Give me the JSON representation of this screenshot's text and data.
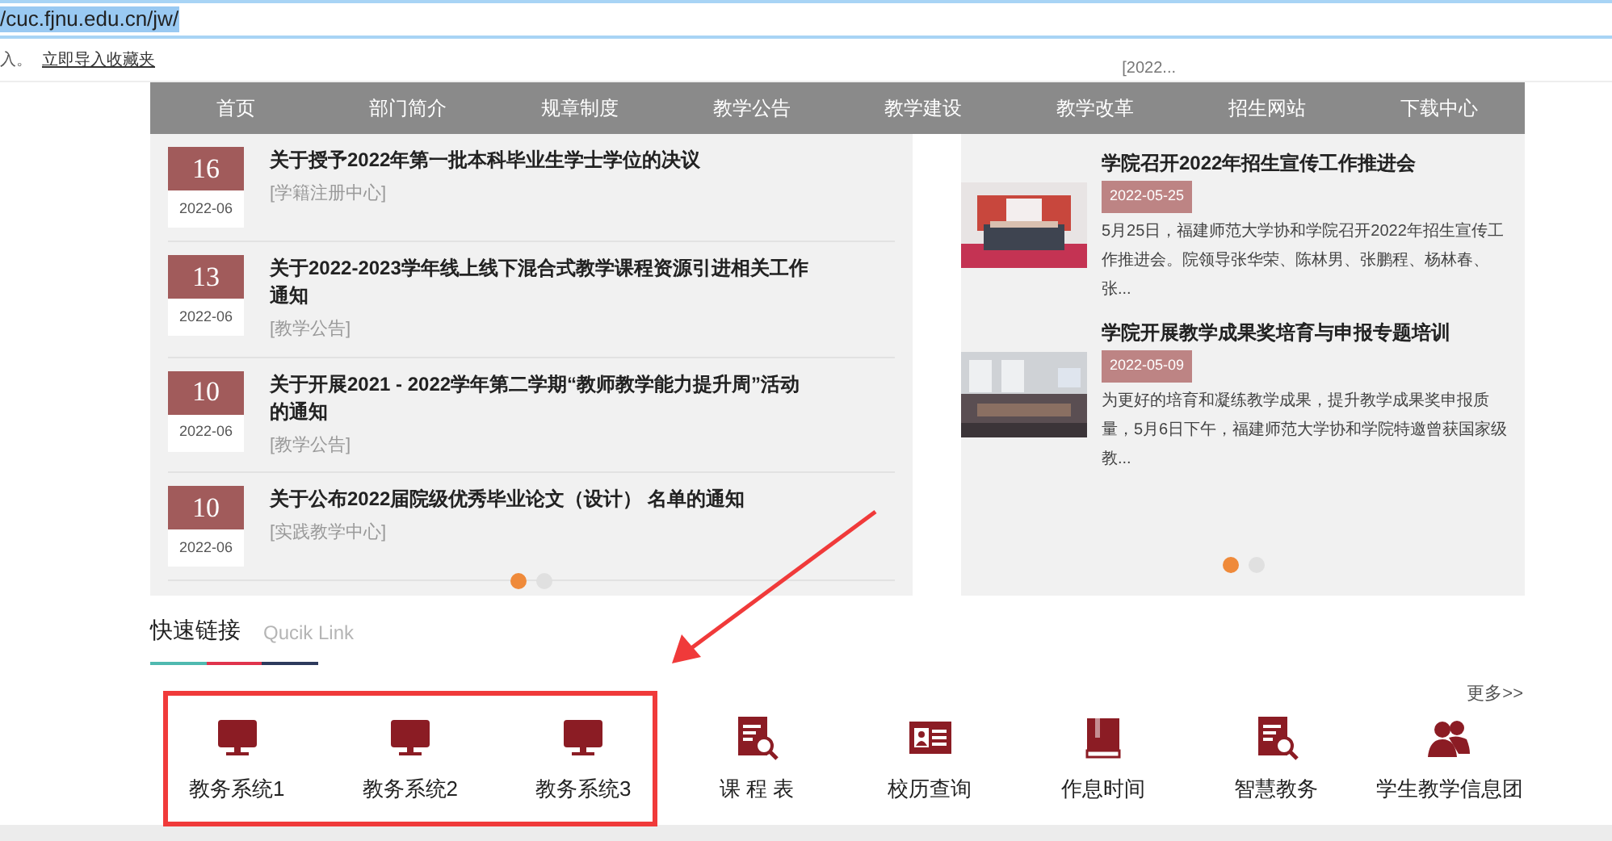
{
  "address_bar": {
    "url": "/cuc.fjnu.edu.cn/jw/"
  },
  "info_bar": {
    "text": "入。",
    "link": "立即导入收藏夹"
  },
  "nav": [
    {
      "label": "首页"
    },
    {
      "label": "部门简介"
    },
    {
      "label": "规章制度"
    },
    {
      "label": "教学公告"
    },
    {
      "label": "教学建设"
    },
    {
      "label": "教学改革"
    },
    {
      "label": "招生网站"
    },
    {
      "label": "下载中心"
    }
  ],
  "notices": [
    {
      "day": "16",
      "month": "2022-06",
      "title": "关于授予2022年第一批本科毕业生学士学位的决议",
      "category": "[学籍注册中心]"
    },
    {
      "day": "13",
      "month": "2022-06",
      "title": "关于2022-2023学年线上线下混合式教学课程资源引进相关工作通知",
      "category": "[教学公告]"
    },
    {
      "day": "10",
      "month": "2022-06",
      "title": "关于开展2021 - 2022学年第二学期“教师教学能力提升周”活动的通知",
      "category": "[教学公告]"
    },
    {
      "day": "10",
      "month": "2022-06",
      "title": "关于公布2022届院级优秀毕业论文（设计） 名单的通知",
      "category": "[实践教学中心]"
    }
  ],
  "notice_pager": [
    {
      "selected": true
    },
    {
      "selected": false
    }
  ],
  "news_overflow_text": "[2022...",
  "news": [
    {
      "title": "学院召开2022年招生宣传工作推进会",
      "date": "2022-05-25",
      "summary": "5月25日，福建师范大学协和学院召开2022年招生宣传工作推进会。院领导张华荣、陈林男、张鹏程、杨林春、张..."
    },
    {
      "title": "学院开展教学成果奖培育与申报专题培训",
      "date": "2022-05-09",
      "summary": "为更好的培育和凝练教学成果，提升教学成果奖申报质量，5月6日下午，福建师范大学协和学院特邀曾获国家级教..."
    }
  ],
  "news_pager": [
    {
      "selected": true
    },
    {
      "selected": false
    }
  ],
  "quick_links": {
    "title": "快速链接",
    "subtitle": "Qucik Link",
    "more": "更多>>",
    "items": [
      {
        "label": "教务系统1",
        "kind": "monitor"
      },
      {
        "label": "教务系统2",
        "kind": "monitor"
      },
      {
        "label": "教务系统3",
        "kind": "monitor"
      },
      {
        "label": "课 程 表",
        "kind": "doc-search"
      },
      {
        "label": "校历查询",
        "kind": "id-card"
      },
      {
        "label": "作息时间",
        "kind": "book"
      },
      {
        "label": "智慧教务",
        "kind": "doc-search"
      },
      {
        "label": "学生教学信息团",
        "kind": "people"
      }
    ]
  }
}
